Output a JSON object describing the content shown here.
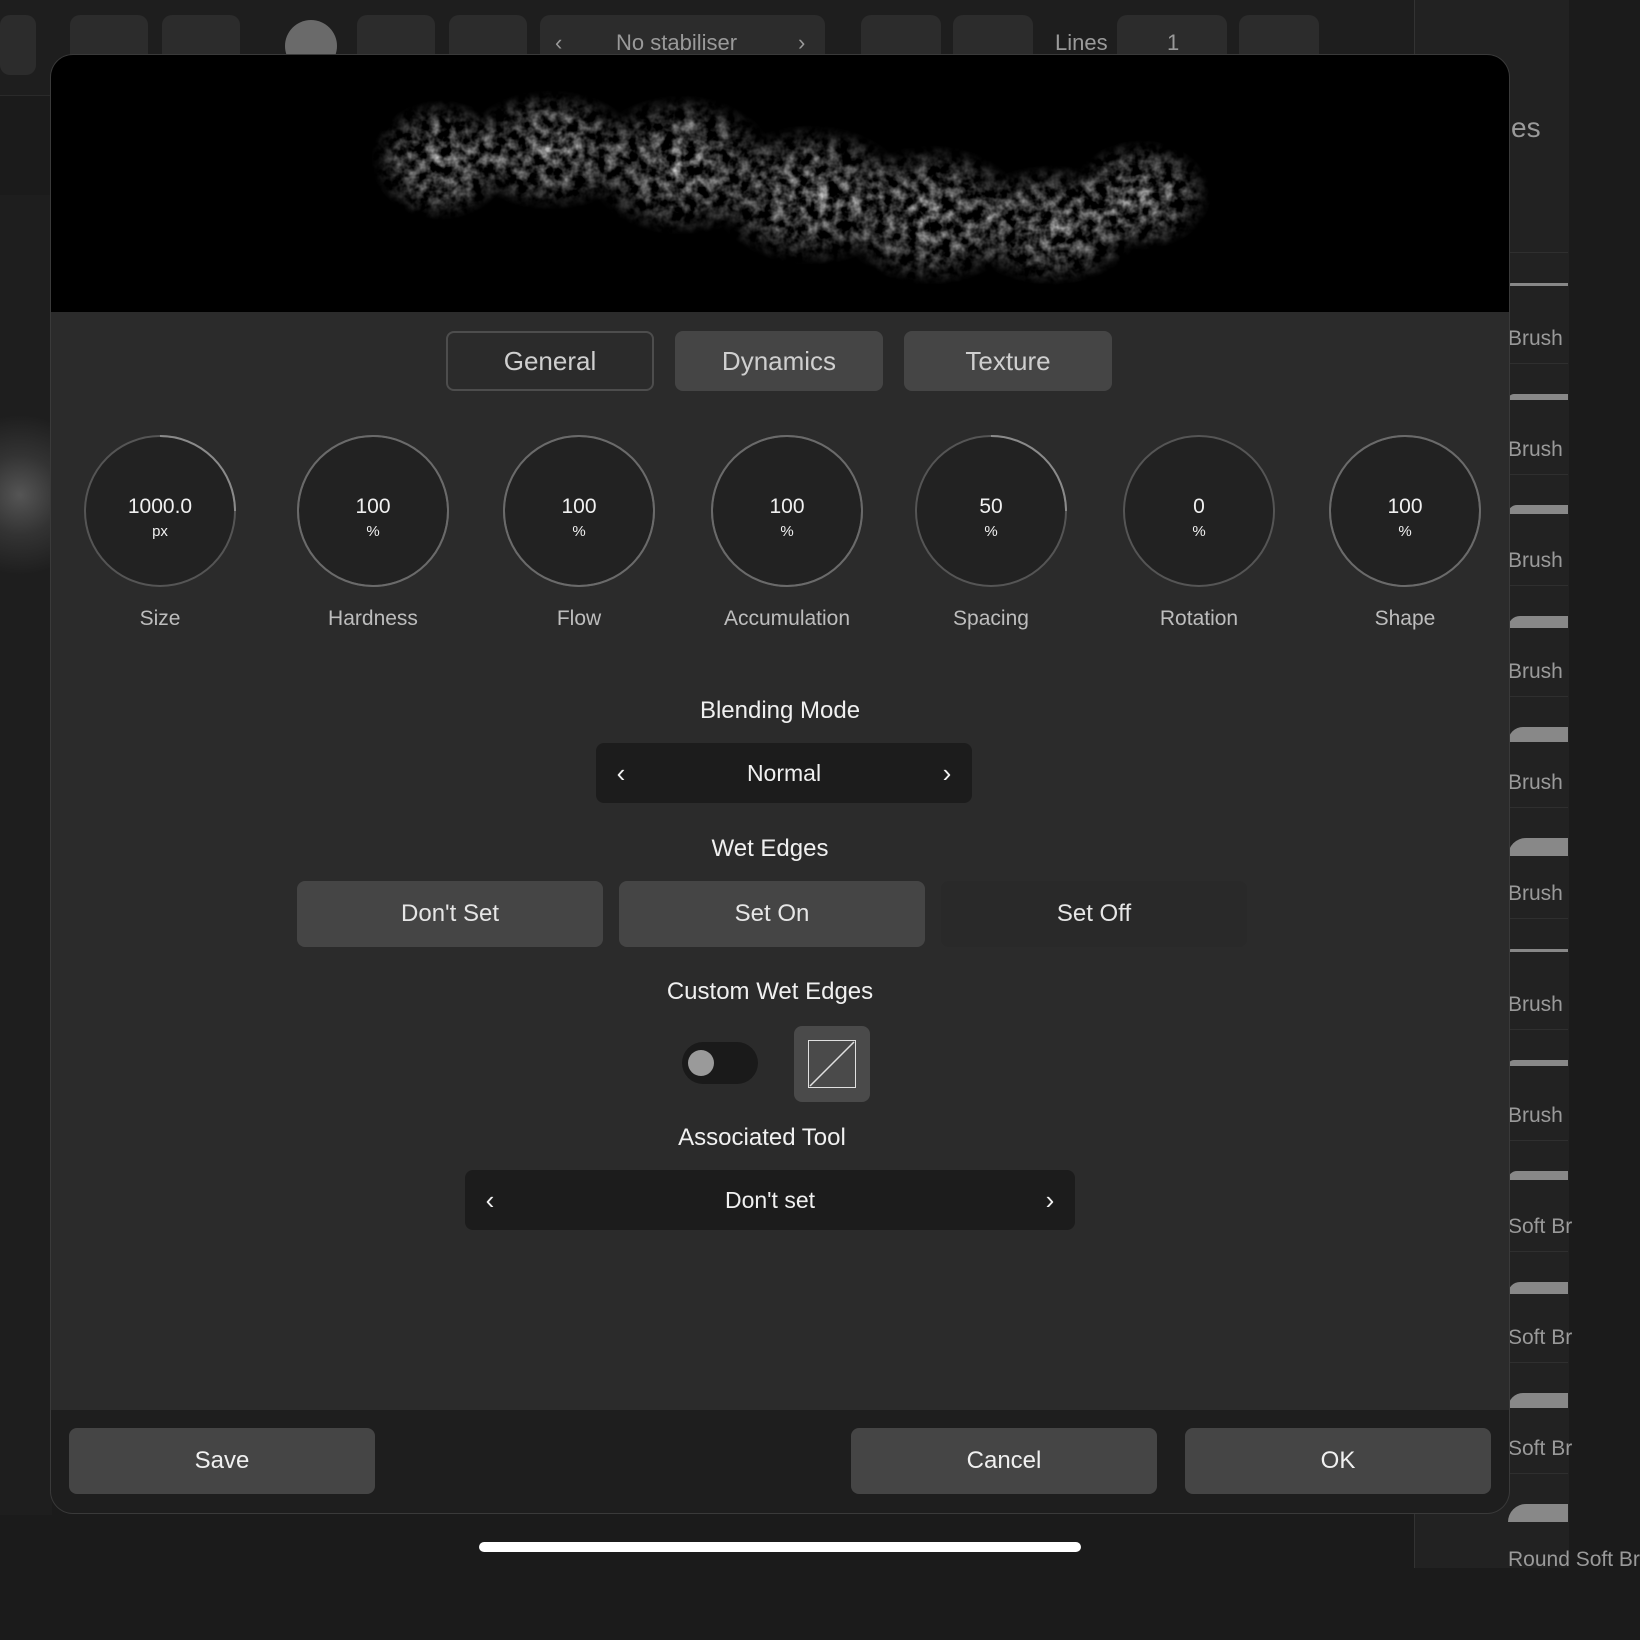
{
  "toolbar": {
    "stabiliser_label": "No stabiliser",
    "lines_label": "Lines",
    "lines_value": "1"
  },
  "right_panel": {
    "header_partial": "es",
    "items": [
      "Brush",
      "Brush",
      "Brush",
      "Brush",
      "Brush",
      "Brush",
      "Brush",
      "Brush",
      "Soft Br",
      "Soft Br",
      "Soft Br",
      "Round Soft Br"
    ]
  },
  "dialog": {
    "tabs": [
      {
        "label": "General",
        "active": true
      },
      {
        "label": "Dynamics",
        "active": false
      },
      {
        "label": "Texture",
        "active": false
      }
    ],
    "dials": [
      {
        "label": "Size",
        "value": "1000.0",
        "unit": "px",
        "level": 0.25
      },
      {
        "label": "Hardness",
        "value": "100",
        "unit": "%",
        "level": 1.0
      },
      {
        "label": "Flow",
        "value": "100",
        "unit": "%",
        "level": 1.0
      },
      {
        "label": "Accumulation",
        "value": "100",
        "unit": "%",
        "level": 1.0
      },
      {
        "label": "Spacing",
        "value": "50",
        "unit": "%",
        "level": 0.25
      },
      {
        "label": "Rotation",
        "value": "0",
        "unit": "%",
        "level": 0.0
      },
      {
        "label": "Shape",
        "value": "100",
        "unit": "%",
        "level": 1.0
      }
    ],
    "blending_mode": {
      "title": "Blending Mode",
      "value": "Normal"
    },
    "wet_edges": {
      "title": "Wet Edges",
      "options": [
        "Don't Set",
        "Set On",
        "Set Off"
      ],
      "selected": "Set Off"
    },
    "custom_wet_edges": {
      "title": "Custom Wet Edges",
      "enabled": false
    },
    "associated_tool": {
      "title": "Associated Tool",
      "value": "Don't set"
    },
    "footer": {
      "save": "Save",
      "cancel": "Cancel",
      "ok": "OK"
    }
  },
  "colors": {
    "dialog_bg": "#2b2b2b",
    "button_bg": "#454545",
    "selector_bg": "#1c1c1c",
    "text": "#f0f0f0"
  }
}
